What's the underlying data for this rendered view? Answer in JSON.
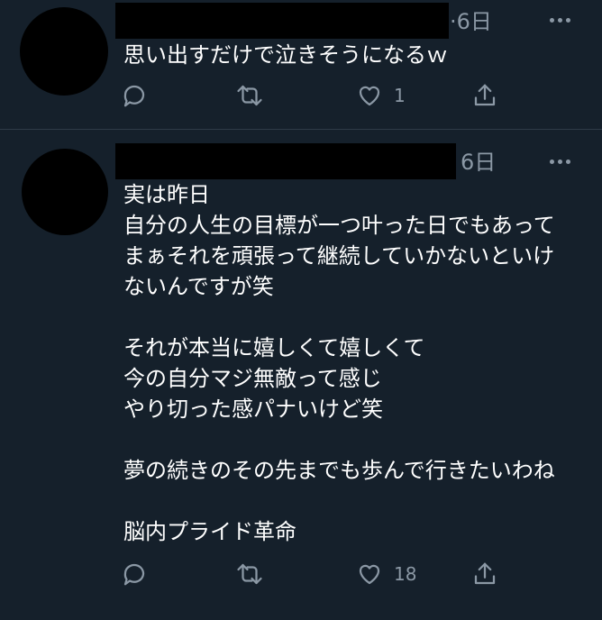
{
  "tweets": [
    {
      "time": "·6日",
      "text": "思い出すだけで泣きそうになるｗ",
      "actions": {
        "like_count": "1"
      }
    },
    {
      "time": "6日",
      "text": "実は昨日\n自分の人生の目標が一つ叶った日でもあって\nまぁそれを頑張って継続していかないといけ\nないんですが笑\n\nそれが本当に嬉しくて嬉しくて\n今の自分マジ無敵って感じ\nやり切った感パナいけど笑\n\n夢の続きのその先までも歩んで行きたいわね\n\n脳内プライド革命",
      "actions": {
        "like_count": "18"
      }
    }
  ],
  "icons": {
    "reply": "reply-icon",
    "retweet": "retweet-icon",
    "like": "heart-icon",
    "share": "share-icon",
    "more": "more-icon"
  },
  "colors": {
    "background": "#15202b",
    "secondary_text": "#8b98a5",
    "divider": "#2f3b47"
  }
}
